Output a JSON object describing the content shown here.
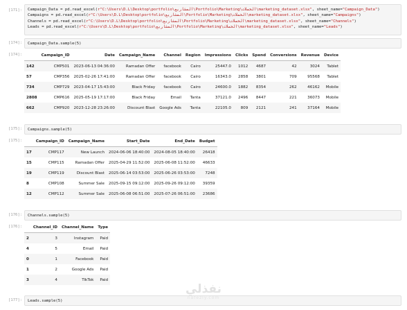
{
  "cells": [
    {
      "prompt": "[171]:",
      "lines": [
        [
          "Campaign_Data = pd.read_excel(",
          "r\"C:\\Users\\D.L\\Desktop\\portfolio\\المشاريع\\Portfolio\\Marketing\\الحملات\\marketing_dataset.xlsx\"",
          ", sheet_name=",
          "\"Campaign_Data\"",
          ")"
        ],
        [
          "Campaigns = pd.read_excel(",
          "r\"C:\\Users\\D.L\\Desktop\\portfolio\\المشاريع\\Portfolio\\Marketing\\الحملات\\marketing_dataset.xlsx\"",
          ", sheet_name=",
          "\"Campaigns\"",
          ")"
        ],
        [
          "Channels = pd.read_excel(",
          "r\"C:\\Users\\D.L\\Desktop\\portfolio\\المشاريع\\Portfolio\\Marketing\\الحملات\\marketing_dataset.xlsx\"",
          ", sheet_name=",
          "\"Channels\"",
          ")"
        ],
        [
          "Leads = pd.read_excel(",
          "r\"C:\\Users\\D.L\\Desktop\\portfolio\\المشاريع\\Portfolio\\Marketing\\الحملات\\marketing_dataset.xlsx\"",
          ", sheet_name=",
          "\"Leads\"",
          ")"
        ]
      ]
    },
    {
      "prompt": "[174]:",
      "code": "Campaign_Data.sample(5)"
    },
    {
      "prompt": "[174]:",
      "output": true
    },
    {
      "prompt": "[175]:",
      "code": "Campaigns.sample(5)"
    },
    {
      "prompt": "[175]:",
      "output": true
    },
    {
      "prompt": "[176]:",
      "code": "Channels.sample(5)"
    },
    {
      "prompt": "[176]:",
      "output": true
    },
    {
      "prompt": "[177]:",
      "code": "Leads.sample(5)"
    }
  ],
  "tables": {
    "campaign_data": {
      "columns": [
        "",
        "Campaign_ID",
        "Date",
        "Campaign_Name",
        "Channel",
        "Region",
        "Impressions",
        "Clicks",
        "Spend",
        "Conversions",
        "Revenue",
        "Device"
      ],
      "rows": [
        [
          "142",
          "CMP501",
          "2023-06-13 04:36:00",
          "Ramadan Offer",
          "facebook",
          "Cairo",
          "25447.0",
          "1012",
          "4687",
          "42",
          "3024",
          "Tablet"
        ],
        [
          "57",
          "CMP356",
          "2025-02-26 17:41:00",
          "Ramadan Offer",
          "facebook",
          "Cairo",
          "16343.0",
          "2858",
          "3801",
          "709",
          "95568",
          "Tablet"
        ],
        [
          "734",
          "CMP729",
          "2023-04-17 15:43:00",
          "Black Friday",
          "facebook",
          "Cairo",
          "24600.0",
          "1882",
          "8354",
          "262",
          "46162",
          "Mobile"
        ],
        [
          "2808",
          "CMP616",
          "2025-05-19 17:17:00",
          "Black Friday",
          "Email",
          "Tanta",
          "37121.0",
          "2496",
          "8447",
          "221",
          "36073",
          "Mobile"
        ],
        [
          "662",
          "CMP920",
          "2023-12-28 23:26:00",
          "Discount Blast",
          "Google Ads",
          "Tanta",
          "22105.0",
          "809",
          "2121",
          "241",
          "37164",
          "Mobile"
        ]
      ]
    },
    "campaigns": {
      "columns": [
        "",
        "Campaign_ID",
        "Campaign_Name",
        "Start_Date",
        "End_Date",
        "Budget"
      ],
      "rows": [
        [
          "17",
          "CMP117",
          "New Launch",
          "2024-06-06 18:40:00",
          "2024-08-05 18:40:00",
          "26418"
        ],
        [
          "15",
          "CMP115",
          "Ramadan Offer",
          "2025-04-29 11:52:00",
          "2025-06-08 11:52:00",
          "46633"
        ],
        [
          "19",
          "CMP119",
          "Discount Blast",
          "2025-06-14 03:53:00",
          "2025-06-26 03:53:00",
          "7248"
        ],
        [
          "8",
          "CMP108",
          "Summer Sale",
          "2025-09-15 09:12:00",
          "2025-09-26 09:12:00",
          "39359"
        ],
        [
          "12",
          "CMP112",
          "Summer Sale",
          "2025-06-08 06:51:00",
          "2025-07-26 06:51:00",
          "23686"
        ]
      ]
    },
    "channels": {
      "columns": [
        "",
        "Channel_ID",
        "Channel_Name",
        "Type"
      ],
      "rows": [
        [
          "2",
          "3",
          "Instagram",
          "Paid"
        ],
        [
          "4",
          "5",
          "Email",
          "Paid"
        ],
        [
          "0",
          "1",
          "Facebook",
          "Paid"
        ],
        [
          "1",
          "2",
          "Google Ads",
          "Paid"
        ],
        [
          "3",
          "4",
          "TikTok",
          "Paid"
        ]
      ]
    }
  },
  "watermark": {
    "arabic": "نفذلي",
    "latin": "nafezly.com"
  }
}
